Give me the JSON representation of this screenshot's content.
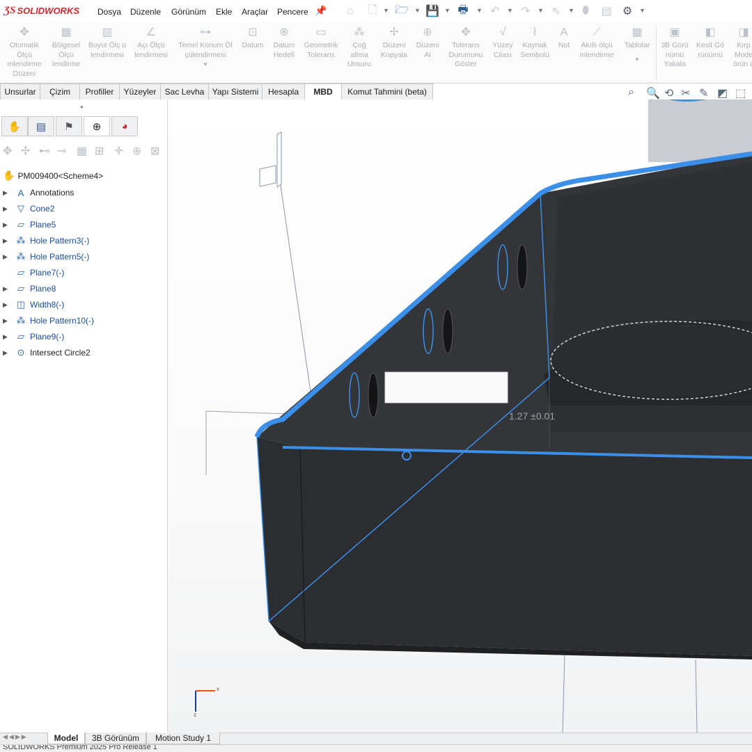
{
  "app": {
    "logo_brand": "SOLIDWORKS"
  },
  "menu": [
    "Dosya",
    "Düzenle",
    "Görünüm",
    "Ekle",
    "Araçlar",
    "Pencere"
  ],
  "ribbon": [
    "Otomatik Ölçü mlendirme Düzeni",
    "Bölgesel Ölçü lendirme",
    "Boyut Ölç ü lendirmesi",
    "Açı Ölçü lendirmesi",
    "Temel Konum Öl çülendirmesi",
    "Datum",
    "Datum Hedefi",
    "Geometrik Tolerans",
    "Çoğ altma Unsuru",
    "Düzeni Kopyala",
    "Düzeni Al",
    "Tolerans Durumunu Göster",
    "Yüzey Cilası",
    "Kaynak Sembolü",
    "Not",
    "Akıllı ölçü mlendirme",
    "Tablolar",
    "3B Görü nümü Yakala",
    "Kesit Gö rünümü",
    "Kırp Mode örün ü"
  ],
  "command_tabs": [
    "Unsurlar",
    "Çizim",
    "Profiller",
    "Yüzeyler",
    "Sac Levha",
    "Yapı Sistemi",
    "Hesapla",
    "MBD",
    "Komut Tahmini (beta)"
  ],
  "active_command_tab": "MBD",
  "tree": {
    "root": "PM009400<Scheme4>",
    "items": [
      {
        "label": "Annotations",
        "icon": "annotations-icon"
      },
      {
        "label": "Cone2",
        "icon": "cone-icon"
      },
      {
        "label": "Plane5",
        "icon": "plane-icon"
      },
      {
        "label": "Hole Pattern3(-)",
        "icon": "hole-pattern-icon"
      },
      {
        "label": "Hole Pattern5(-)",
        "icon": "hole-pattern-icon"
      },
      {
        "label": "Plane7(-)",
        "icon": "plane-icon"
      },
      {
        "label": "Plane8",
        "icon": "plane-icon"
      },
      {
        "label": "Width8(-)",
        "icon": "width-icon"
      },
      {
        "label": "Hole Pattern10(-)",
        "icon": "hole-pattern-icon"
      },
      {
        "label": "Plane9(-)",
        "icon": "plane-icon"
      },
      {
        "label": "Intersect Circle2",
        "icon": "intersect-circle-icon"
      }
    ]
  },
  "viewport": {
    "dimension_text": "1.27 ±0.01",
    "triad_x_label": "x",
    "triad_z_label": "z"
  },
  "bottom_tabs": [
    "Model",
    "3B Görünüm",
    "Motion Study 1"
  ],
  "status": "SOLIDWORKS Premium 2025 Pro Release 1",
  "colors": {
    "highlight": "#3b8fe8",
    "part_body": "#2b2d30",
    "brand": "#d3282e"
  }
}
